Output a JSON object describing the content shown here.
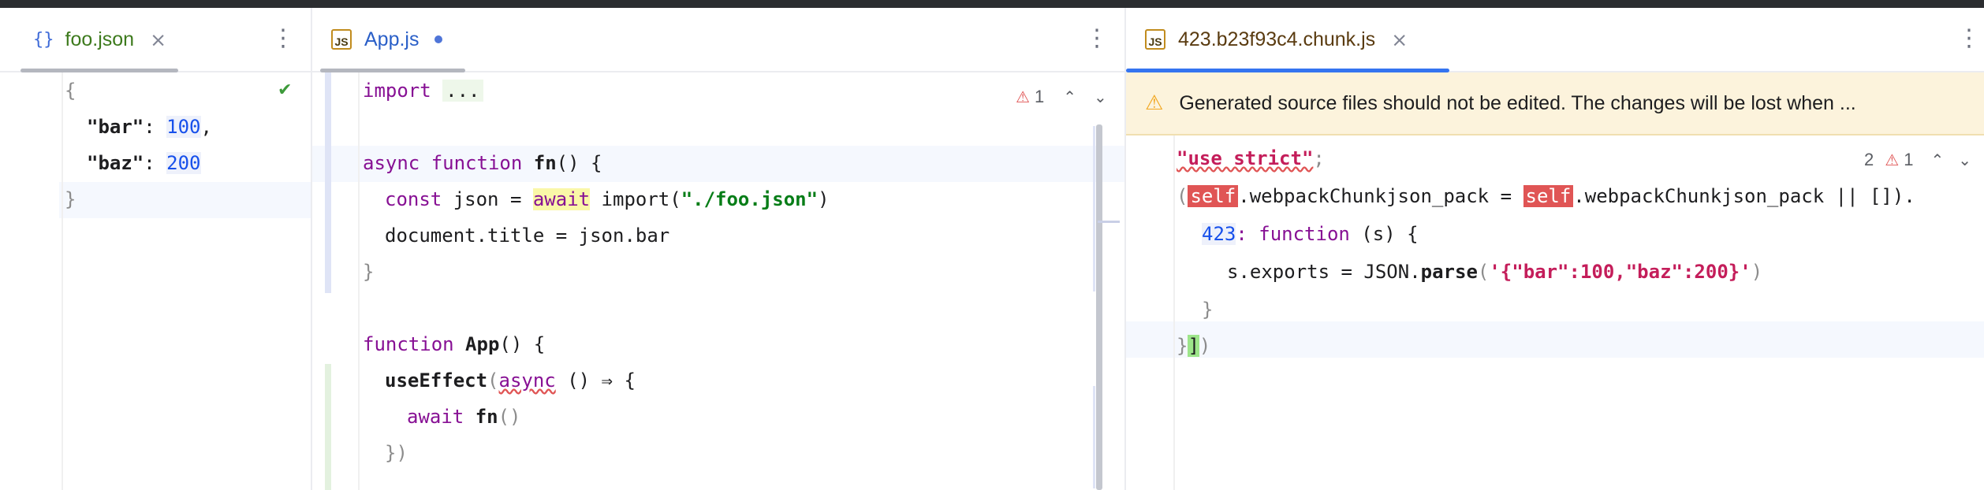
{
  "colors": {
    "tab_underline": "#b4b7bf",
    "accent": "#3574f0",
    "warning": "#f2a823",
    "error": "#e05555"
  },
  "panes": {
    "foo": {
      "tab": {
        "icon": "{}",
        "label": "foo.json",
        "close": "×"
      },
      "kebab": "⋮",
      "status_icon": "✔",
      "code": {
        "l1": "{",
        "l2_key": "\"bar\"",
        "l2_colon": ": ",
        "l2_val": "100",
        "l2_comma": ",",
        "l3_key": "\"baz\"",
        "l3_colon": ": ",
        "l3_val": "200",
        "l4": "}"
      }
    },
    "app": {
      "tab": {
        "icon": "JS",
        "label": "App.js"
      },
      "kebab": "⋮",
      "inspection": {
        "count": "1",
        "up": "⌃",
        "down": "⌄"
      },
      "code": {
        "import_kw": "import",
        "import_fold": "...",
        "async_kw": "async",
        "function_kw": "function",
        "fn_name": "fn",
        "fn_rest": "() {",
        "const_kw": "const",
        "json_var": " json = ",
        "await_kw": "await",
        "import2": " import(",
        "path_str": "\"./foo.json\"",
        "close_paren": ")",
        "document": "document",
        "dot_title": ".title",
        "assign_bar": " = json.bar",
        "close_brace": "}",
        "function_kw2": "function",
        "app_name": "App",
        "app_rest": "() {",
        "use_effect": "useEffect",
        "ue_paren": "(",
        "async2": "async",
        "arrow": " () ⇒ {",
        "await2": "await",
        "fn_call": "fn",
        "call_paren": "()",
        "close_obj": "})"
      }
    },
    "chunk": {
      "tab": {
        "icon": "JS",
        "label": "423.b23f93c4.chunk.js",
        "close": "×"
      },
      "kebab": "⋮",
      "banner": "Generated source files should not be edited. The changes will be lost when ...",
      "inspection": {
        "weak": "2",
        "errors": "1",
        "up": "⌃",
        "down": "⌄"
      },
      "code": {
        "use_strict": "\"use strict\"",
        "semicolon": ";",
        "paren_open": "(",
        "self1": "self",
        "chunk_prop1": ".webpackChunkjson_pack",
        "eq": " = ",
        "self2": "self",
        "chunk_prop2": ".webpackChunkjson_pack",
        "or_empty": " || [])",
        "dot_push": ".",
        "module_id": "423",
        "fn_kw": ": function",
        "fn_args": " (s) {",
        "s_var": "s",
        "exports": ".exports",
        "json_parse": " = JSON.",
        "parse": "parse",
        "parse_open": "(",
        "parse_str": "'{\"bar\":100,\"baz\":200}'",
        "parse_close": ")",
        "inner_close": "}",
        "outer_close": "}",
        "bracket": "]",
        "final_paren": ")"
      }
    }
  }
}
